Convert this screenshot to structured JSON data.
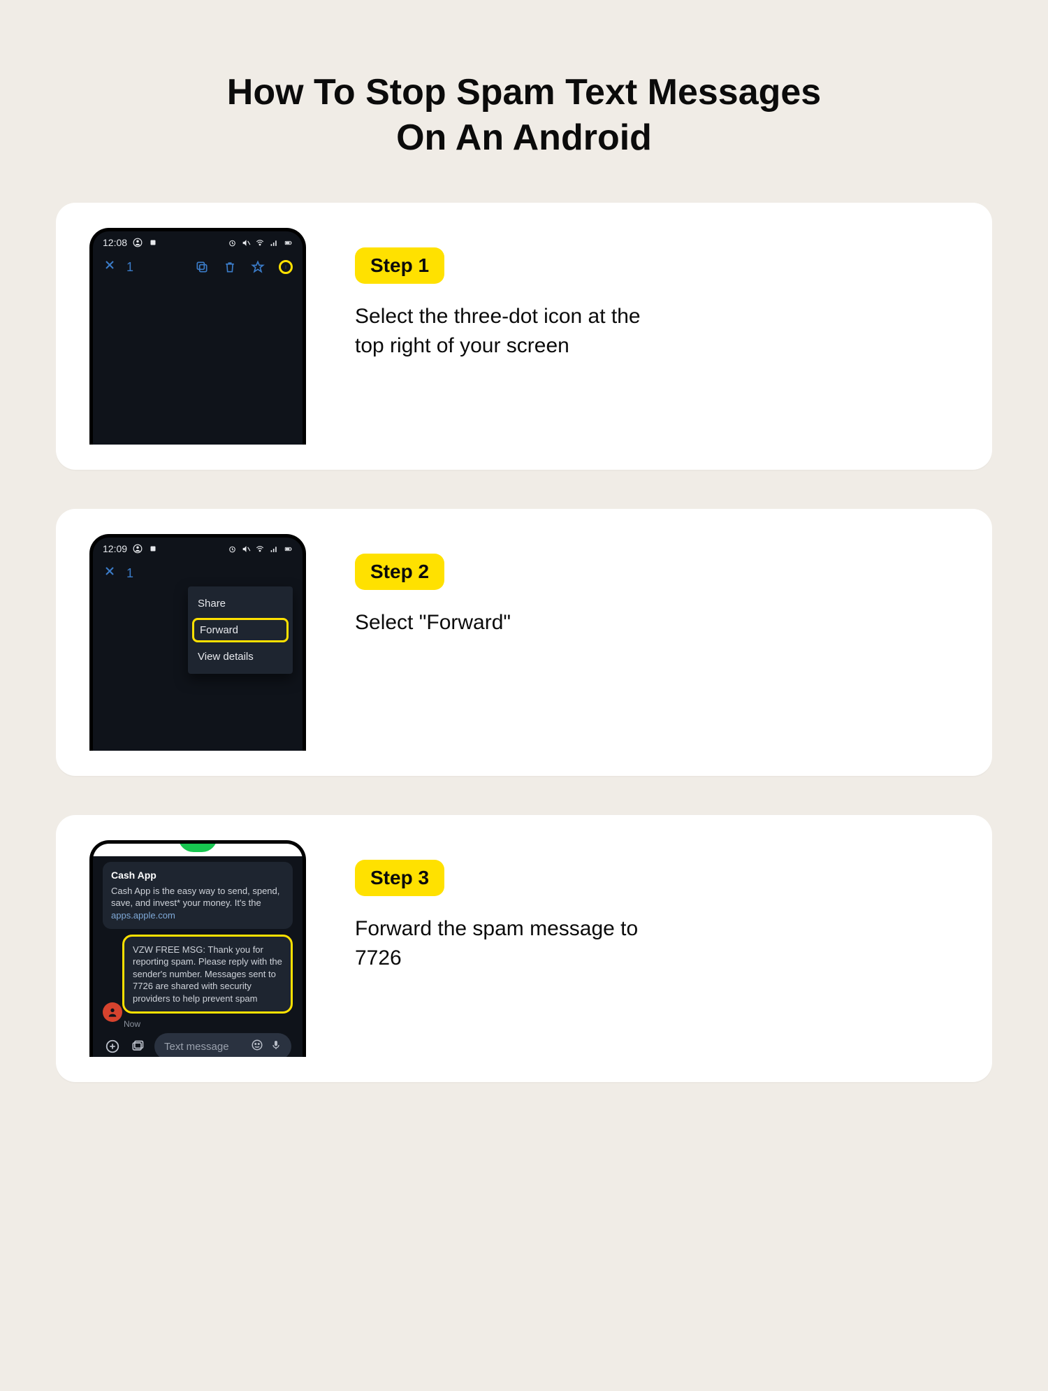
{
  "title": "How To Stop Spam Text Messages On An Android",
  "steps": [
    {
      "tag": "Step 1",
      "desc": "Select the three-dot icon at the top right of your screen",
      "phone": {
        "time": "12:08",
        "count": "1"
      }
    },
    {
      "tag": "Step 2",
      "desc": "Select \"Forward\"",
      "phone": {
        "time": "12:09",
        "count": "1"
      },
      "menu": {
        "share": "Share",
        "forward": "Forward",
        "details": "View details"
      }
    },
    {
      "tag": "Step 3",
      "desc": "Forward the spam message to 7726",
      "chat": {
        "card_title": "Cash App",
        "card_body": "Cash App is the easy way to send, spend, save, and invest* your money. It's the",
        "card_link": "apps.apple.com",
        "reply": "VZW FREE MSG: Thank you for reporting spam. Please reply with the sender's number. Messages sent to 7726 are shared with security providers to help prevent spam",
        "ts": "Now",
        "placeholder": "Text message"
      }
    }
  ]
}
